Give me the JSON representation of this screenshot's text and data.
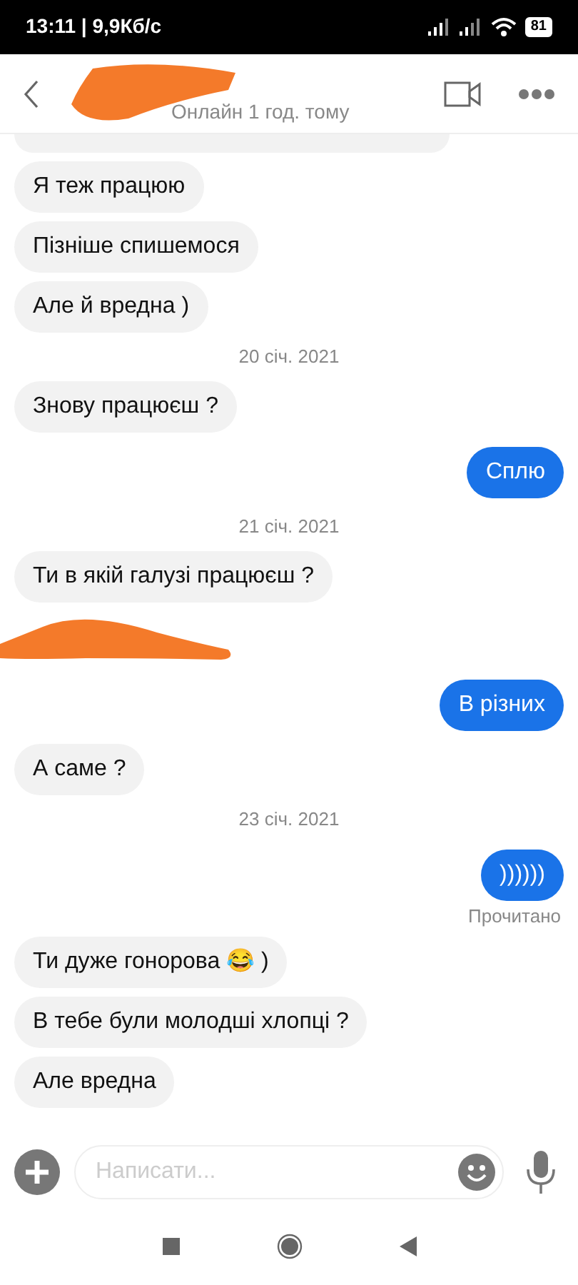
{
  "status_bar": {
    "time": "13:11 | 9,9Кб/с",
    "battery": "81"
  },
  "header": {
    "subtitle": "Онлайн 1 год. тому"
  },
  "messages": [
    {
      "kind": "partial"
    },
    {
      "kind": "incoming",
      "text": "Я теж працюю"
    },
    {
      "kind": "incoming",
      "text": "Пізніше спишемося"
    },
    {
      "kind": "incoming",
      "text": "Але й вредна )"
    },
    {
      "kind": "date",
      "text": "20 січ. 2021"
    },
    {
      "kind": "incoming",
      "text": "Знову працюєш ?"
    },
    {
      "kind": "outgoing",
      "text": "Сплю"
    },
    {
      "kind": "date",
      "text": "21 січ. 2021"
    },
    {
      "kind": "incoming",
      "text": "Ти в якій галузі працюєш ?"
    },
    {
      "kind": "scribble"
    },
    {
      "kind": "outgoing",
      "text": "В різних"
    },
    {
      "kind": "incoming",
      "text": "А саме ?"
    },
    {
      "kind": "date",
      "text": "23 січ. 2021"
    },
    {
      "kind": "outgoing",
      "text": "))))))"
    },
    {
      "kind": "receipt",
      "text": "Прочитано"
    },
    {
      "kind": "incoming",
      "text": "Ти дуже гонорова 😂 )"
    },
    {
      "kind": "incoming",
      "text": "В тебе були молодші хлопці ?"
    },
    {
      "kind": "incoming",
      "text": "Але вредна"
    }
  ],
  "composer": {
    "placeholder": "Написати..."
  }
}
